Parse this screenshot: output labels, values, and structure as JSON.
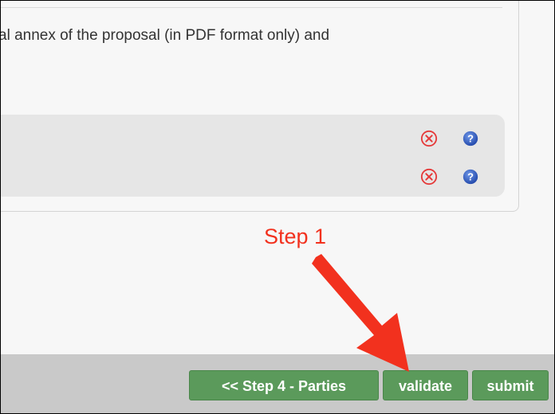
{
  "panel": {
    "annex_text": "al annex of the proposal (in PDF format only) and"
  },
  "uploads": {
    "rows": [
      {
        "remove_icon": "remove-circle-icon",
        "help_icon": "question-icon"
      },
      {
        "remove_icon": "remove-circle-icon",
        "help_icon": "question-icon"
      }
    ],
    "remove_color": "#e53a3a",
    "help_color": "#2f5fc4"
  },
  "annotation": {
    "step_label": "Step 1",
    "color": "#f2311e"
  },
  "footer": {
    "back_label": "<< Step 4 - Parties",
    "validate_label": "validate",
    "submit_label": "submit",
    "button_color": "#5b9a5b"
  }
}
